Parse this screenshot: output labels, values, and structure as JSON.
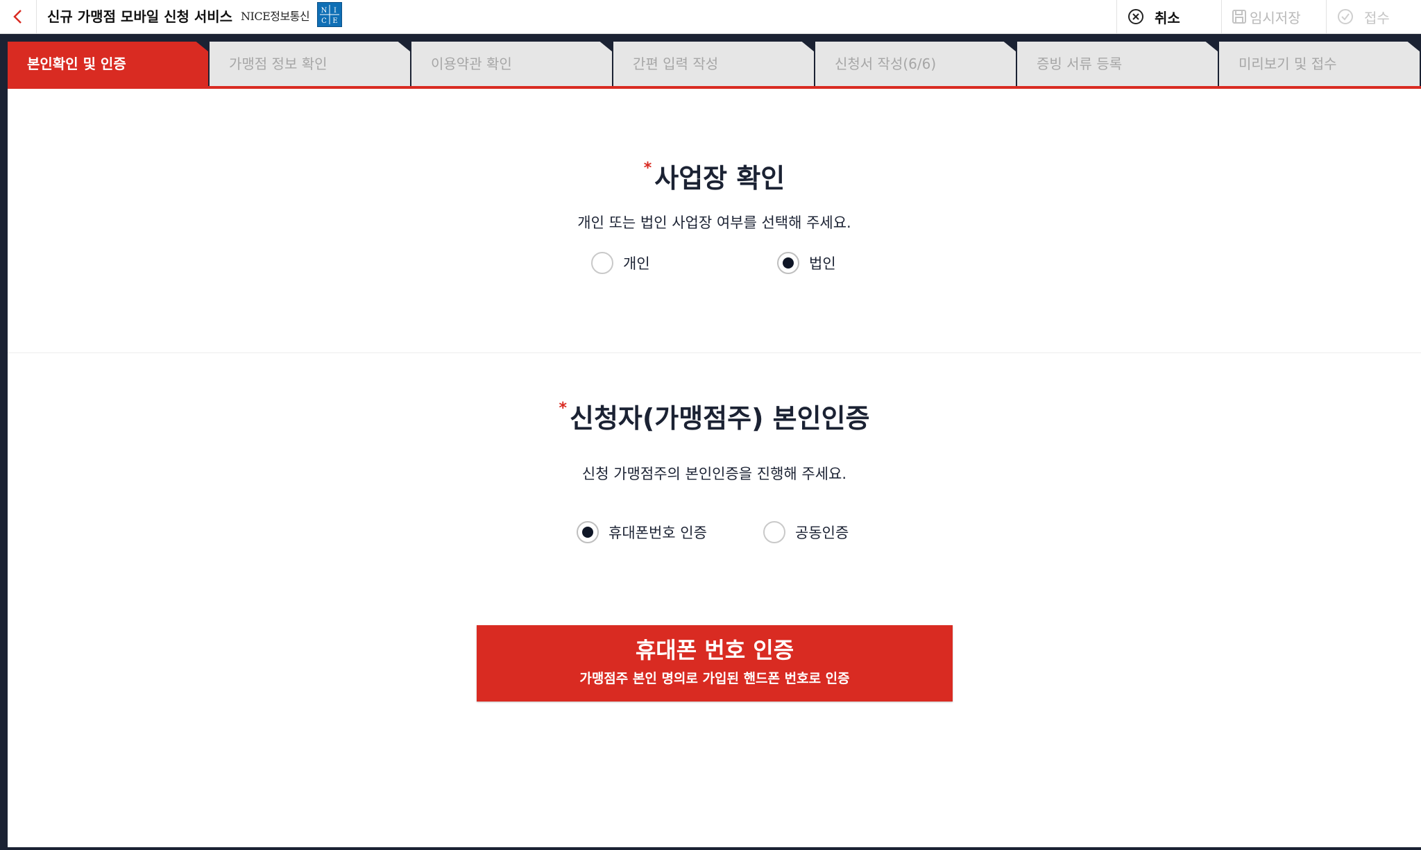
{
  "header": {
    "title": "신규 가맹점 모바일 신청 서비스",
    "brand": "NICE정보통신",
    "logo_text": "NICE",
    "actions": {
      "cancel": "취소",
      "temp_save": "임시저장",
      "submit": "접수"
    }
  },
  "steps": [
    {
      "label": "본인확인 및 인증",
      "active": true
    },
    {
      "label": "가맹점 정보 확인",
      "active": false
    },
    {
      "label": "이용약관 확인",
      "active": false
    },
    {
      "label": "간편 입력 작성",
      "active": false
    },
    {
      "label": "신청서 작성(6/6)",
      "active": false
    },
    {
      "label": "증빙 서류 등록",
      "active": false
    },
    {
      "label": "미리보기 및 접수",
      "active": false
    }
  ],
  "business": {
    "required_mark": "*",
    "title": "사업장 확인",
    "description": "개인 또는 법인 사업장 여부를 선택해 주세요.",
    "options": [
      {
        "label": "개인",
        "selected": false
      },
      {
        "label": "법인",
        "selected": true
      }
    ]
  },
  "auth": {
    "required_mark": "*",
    "title": "신청자(가맹점주) 본인인증",
    "description": "신청 가맹점주의 본인인증을 진행해 주세요.",
    "options": [
      {
        "label": "휴대폰번호 인증",
        "selected": true
      },
      {
        "label": "공동인증",
        "selected": false
      }
    ]
  },
  "cta": {
    "title": "휴대폰 번호 인증",
    "subtitle": "가맹점주 본인 명의로 가입된 핸드폰 번호로 인증"
  },
  "colors": {
    "accent": "#d92b22",
    "frame": "#1b2233",
    "inactive_tab": "#e6e6e6",
    "inactive_text": "#a6a6a6"
  }
}
